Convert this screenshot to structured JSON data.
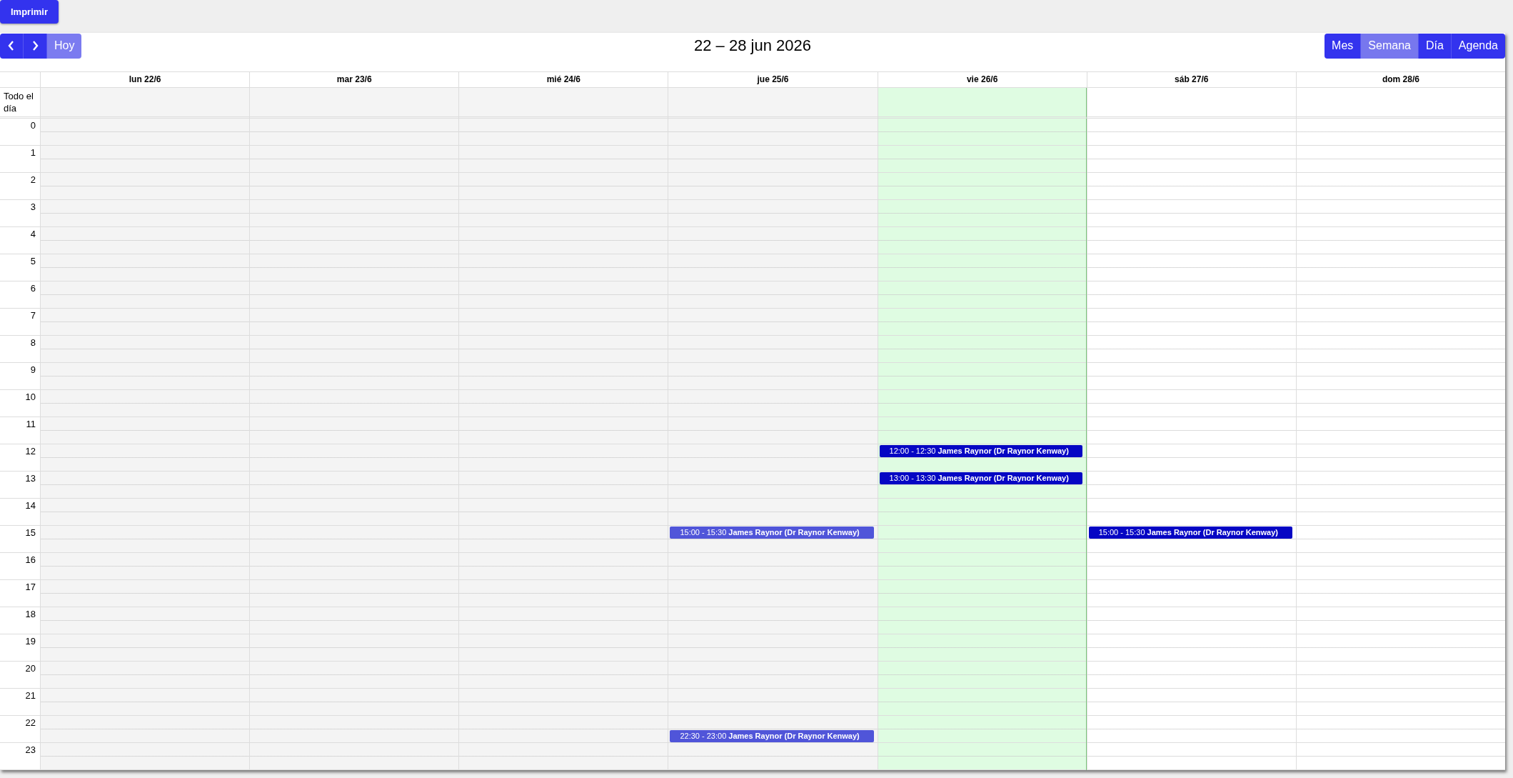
{
  "print_button": "Imprimir",
  "toolbar": {
    "nav": [
      {
        "kind": "prev",
        "disabled": false
      },
      {
        "kind": "next",
        "disabled": false
      },
      {
        "kind": "today",
        "label": "Hoy",
        "disabled": true
      }
    ],
    "title": "22 – 28 jun 2026",
    "views": [
      {
        "label": "Mes",
        "selected": false
      },
      {
        "label": "Semana",
        "selected": true
      },
      {
        "label": "Día",
        "selected": false
      },
      {
        "label": "Agenda",
        "selected": false
      }
    ]
  },
  "all_day_label": "Todo el día",
  "hours": [
    "0",
    "1",
    "2",
    "3",
    "4",
    "5",
    "6",
    "7",
    "8",
    "9",
    "10",
    "11",
    "12",
    "13",
    "14",
    "15",
    "16",
    "17",
    "18",
    "19",
    "20",
    "21",
    "22",
    "23"
  ],
  "days": [
    {
      "label": "lun 22/6",
      "kind": "past"
    },
    {
      "label": "mar 23/6",
      "kind": "past"
    },
    {
      "label": "mié 24/6",
      "kind": "past"
    },
    {
      "label": "jue 25/6",
      "kind": "past",
      "events": [
        {
          "time": "15:00 - 15:30",
          "title": "James Raynor (Dr Raynor Kenway)",
          "past": true
        },
        {
          "time": "22:30 - 23:00",
          "title": "James Raynor (Dr Raynor Kenway)",
          "past": true
        }
      ]
    },
    {
      "label": "vie 26/6",
      "kind": "today",
      "events": [
        {
          "time": "12:00 - 12:30",
          "title": "James Raynor (Dr Raynor Kenway)",
          "past": false
        },
        {
          "time": "13:00 - 13:30",
          "title": "James Raynor (Dr Raynor Kenway)",
          "past": false
        }
      ]
    },
    {
      "label": "sáb 27/6",
      "kind": "future",
      "events": [
        {
          "time": "15:00 - 15:30",
          "title": "James Raynor (Dr Raynor Kenway)",
          "past": false
        }
      ]
    },
    {
      "label": "dom 28/6",
      "kind": "future"
    }
  ]
}
